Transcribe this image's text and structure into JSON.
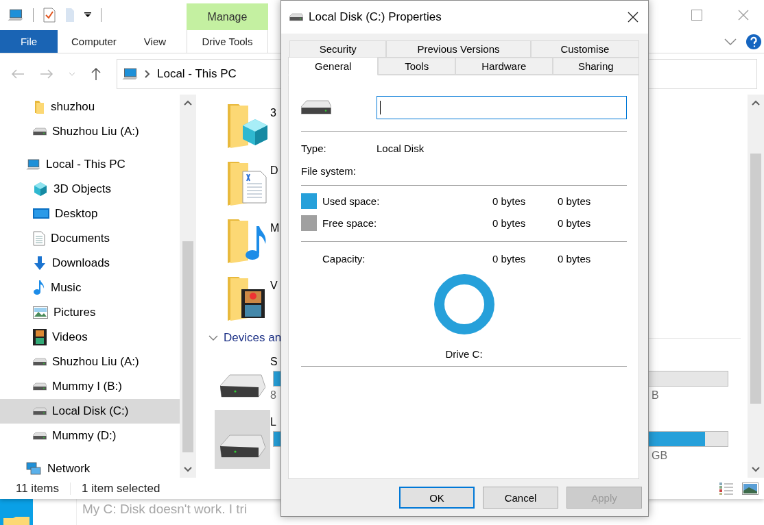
{
  "explorer": {
    "contextual_tab": {
      "group": "Manage",
      "tab": "Drive Tools"
    },
    "ribbon_tabs": [
      {
        "label": "File",
        "kind": "file"
      },
      {
        "label": "Computer",
        "kind": "tab"
      },
      {
        "label": "View",
        "kind": "tab"
      }
    ],
    "address": {
      "path": "Local - This PC"
    },
    "nav_pane": {
      "pinned": [
        {
          "label": "shuzhou",
          "kind": "folder",
          "selected": false
        },
        {
          "label": "Shuzhou Liu (A:)",
          "kind": "drive",
          "selected": false
        }
      ],
      "tree": [
        {
          "label": "Local - This PC",
          "kind": "pc",
          "selected": false,
          "children": [
            {
              "label": "3D Objects",
              "kind": "cube",
              "selected": false
            },
            {
              "label": "Desktop",
              "kind": "desktop",
              "selected": false
            },
            {
              "label": "Documents",
              "kind": "documents",
              "selected": false
            },
            {
              "label": "Downloads",
              "kind": "downloads",
              "selected": false
            },
            {
              "label": "Music",
              "kind": "music",
              "selected": false
            },
            {
              "label": "Pictures",
              "kind": "pictures",
              "selected": false
            },
            {
              "label": "Videos",
              "kind": "videos",
              "selected": false
            },
            {
              "label": "Shuzhou Liu (A:)",
              "kind": "drive",
              "selected": false
            },
            {
              "label": "Mummy I (B:)",
              "kind": "drive",
              "selected": false
            },
            {
              "label": "Local Disk (C:)",
              "kind": "drive",
              "selected": true
            },
            {
              "label": "Mummy (D:)",
              "kind": "drive",
              "selected": false
            }
          ]
        },
        {
          "label": "Network",
          "kind": "network",
          "selected": false
        }
      ]
    },
    "content": {
      "folders": [
        {
          "label": "3",
          "kind": "cube"
        },
        {
          "label": "D",
          "kind": "documents"
        },
        {
          "label": "M",
          "kind": "music"
        },
        {
          "label": "V",
          "kind": "videos"
        }
      ],
      "group": {
        "label": "Devices an",
        "expanded": true
      },
      "drives": [
        {
          "name": "S",
          "level": 0.45,
          "detail": "8",
          "detail_end": "B",
          "selected": false
        },
        {
          "name": "L",
          "level": 0.95,
          "detail_end": "GB",
          "selected": true
        }
      ]
    },
    "status_bar": {
      "count": "11 items",
      "selection": "1 item selected"
    }
  },
  "dialog": {
    "title": "Local Disk (C:) Properties",
    "tab_rows": [
      [
        {
          "label": "Security",
          "selected": false
        },
        {
          "label": "Previous Versions",
          "selected": false
        },
        {
          "label": "Customise",
          "selected": false
        }
      ],
      [
        {
          "label": "General",
          "selected": true
        },
        {
          "label": "Tools",
          "selected": false
        },
        {
          "label": "Hardware",
          "selected": false
        },
        {
          "label": "Sharing",
          "selected": false
        }
      ]
    ],
    "name_field": {
      "focused": true
    },
    "info": [
      {
        "label": "Type:",
        "value": "Local Disk"
      },
      {
        "label": "File system:"
      }
    ],
    "space": [
      {
        "label": "Used space:",
        "color": "#26a0da",
        "bytes": "0 bytes",
        "size": "0 bytes"
      },
      {
        "label": "Free space:",
        "color": "#a0a0a0",
        "bytes": "0 bytes",
        "size": "0 bytes"
      }
    ],
    "capacity": {
      "label": "Capacity:",
      "bytes": "0 bytes",
      "size": "0 bytes"
    },
    "drive_label": "Drive C:",
    "buttons": [
      {
        "label": "OK",
        "focused": true,
        "disabled": false
      },
      {
        "label": "Cancel",
        "focused": false,
        "disabled": false
      },
      {
        "label": "Apply",
        "focused": false,
        "disabled": true
      }
    ]
  },
  "desktop": {
    "note": "My C: Disk doesn't work. I tri"
  }
}
